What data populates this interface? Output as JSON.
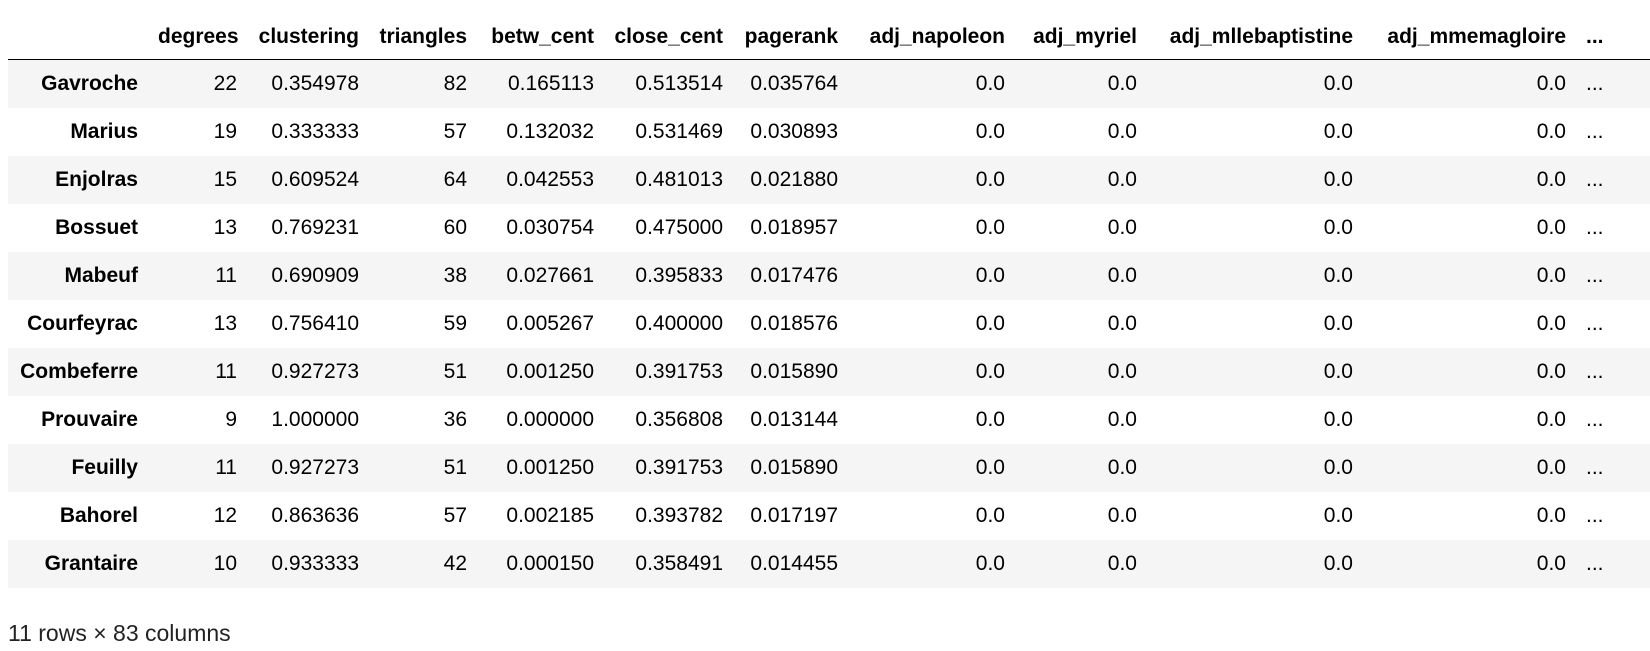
{
  "table": {
    "columns": [
      "degrees",
      "clustering",
      "triangles",
      "betw_cent",
      "close_cent",
      "pagerank",
      "adj_napoleon",
      "adj_myriel",
      "adj_mllebaptistine",
      "adj_mmemagloire",
      "..."
    ],
    "rows": [
      {
        "index": "Gavroche",
        "cells": [
          "22",
          "0.354978",
          "82",
          "0.165113",
          "0.513514",
          "0.035764",
          "0.0",
          "0.0",
          "0.0",
          "0.0",
          "..."
        ]
      },
      {
        "index": "Marius",
        "cells": [
          "19",
          "0.333333",
          "57",
          "0.132032",
          "0.531469",
          "0.030893",
          "0.0",
          "0.0",
          "0.0",
          "0.0",
          "..."
        ]
      },
      {
        "index": "Enjolras",
        "cells": [
          "15",
          "0.609524",
          "64",
          "0.042553",
          "0.481013",
          "0.021880",
          "0.0",
          "0.0",
          "0.0",
          "0.0",
          "..."
        ]
      },
      {
        "index": "Bossuet",
        "cells": [
          "13",
          "0.769231",
          "60",
          "0.030754",
          "0.475000",
          "0.018957",
          "0.0",
          "0.0",
          "0.0",
          "0.0",
          "..."
        ]
      },
      {
        "index": "Mabeuf",
        "cells": [
          "11",
          "0.690909",
          "38",
          "0.027661",
          "0.395833",
          "0.017476",
          "0.0",
          "0.0",
          "0.0",
          "0.0",
          "..."
        ]
      },
      {
        "index": "Courfeyrac",
        "cells": [
          "13",
          "0.756410",
          "59",
          "0.005267",
          "0.400000",
          "0.018576",
          "0.0",
          "0.0",
          "0.0",
          "0.0",
          "..."
        ]
      },
      {
        "index": "Combeferre",
        "cells": [
          "11",
          "0.927273",
          "51",
          "0.001250",
          "0.391753",
          "0.015890",
          "0.0",
          "0.0",
          "0.0",
          "0.0",
          "..."
        ]
      },
      {
        "index": "Prouvaire",
        "cells": [
          "9",
          "1.000000",
          "36",
          "0.000000",
          "0.356808",
          "0.013144",
          "0.0",
          "0.0",
          "0.0",
          "0.0",
          "..."
        ]
      },
      {
        "index": "Feuilly",
        "cells": [
          "11",
          "0.927273",
          "51",
          "0.001250",
          "0.391753",
          "0.015890",
          "0.0",
          "0.0",
          "0.0",
          "0.0",
          "..."
        ]
      },
      {
        "index": "Bahorel",
        "cells": [
          "12",
          "0.863636",
          "57",
          "0.002185",
          "0.393782",
          "0.017197",
          "0.0",
          "0.0",
          "0.0",
          "0.0",
          "..."
        ]
      },
      {
        "index": "Grantaire",
        "cells": [
          "10",
          "0.933333",
          "42",
          "0.000150",
          "0.358491",
          "0.014455",
          "0.0",
          "0.0",
          "0.0",
          "0.0",
          "..."
        ]
      }
    ]
  },
  "footer": {
    "shape_text": "11 rows × 83 columns"
  }
}
